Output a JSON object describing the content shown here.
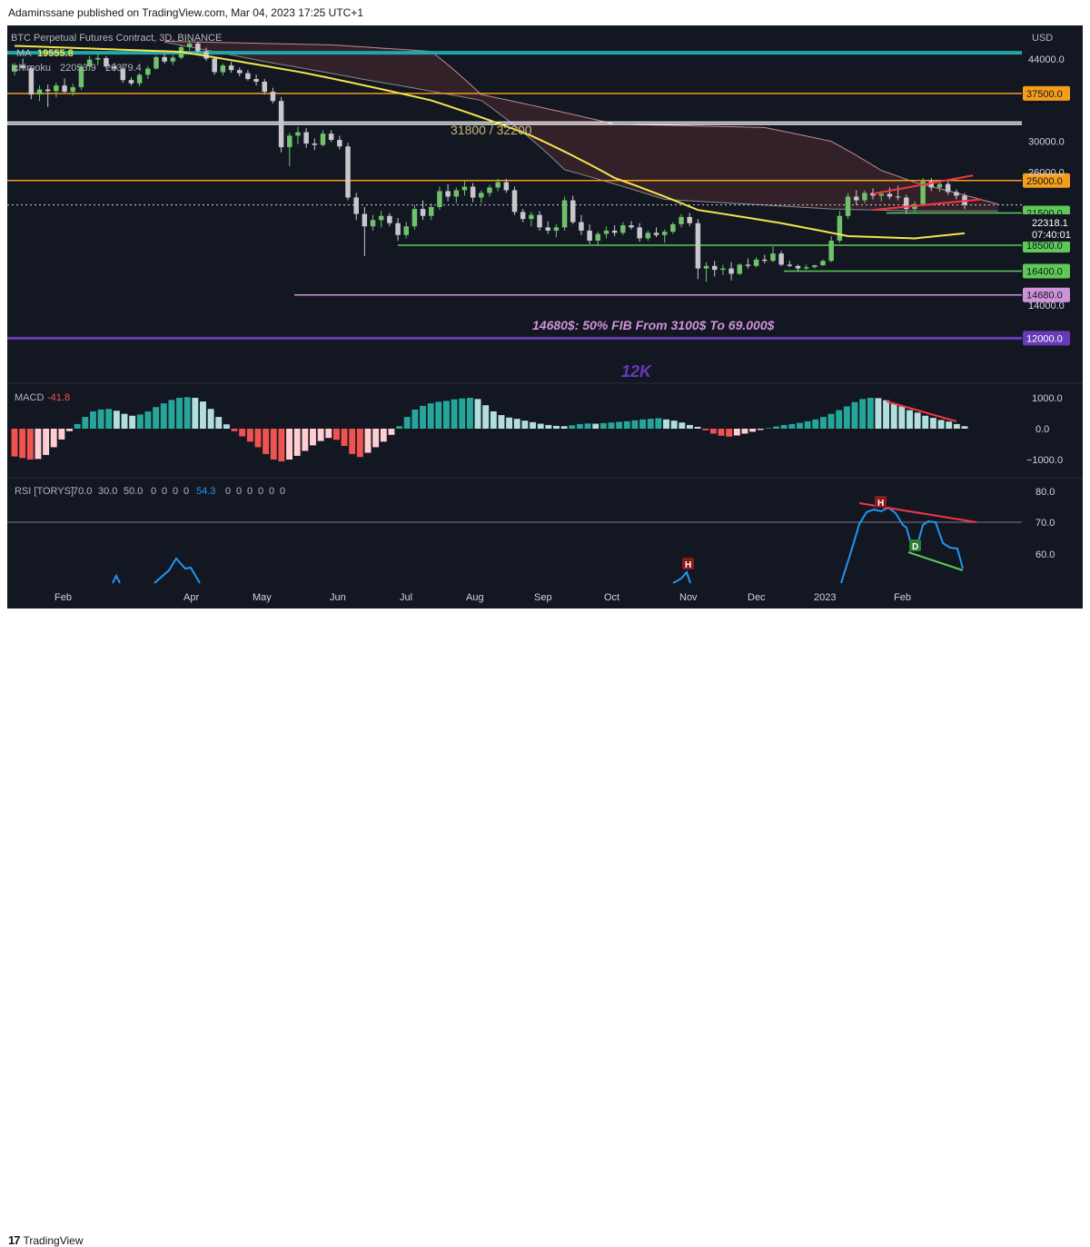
{
  "header": {
    "published": "Adaminssane published on TradingView.com, Mar 04, 2023 17:25 UTC+1"
  },
  "footer": {
    "brand": "TradingView",
    "brand_mark": "17"
  },
  "legend": {
    "symbol": "BTC Perpetual Futures Contract, 3D, BINANCE",
    "ma_label": "MA",
    "ma_value": "19555.8",
    "ichimoku_label": "Ichimoku",
    "ichimoku_v1": "22053.9",
    "ichimoku_v2": "20379.4",
    "currency": "USD"
  },
  "colors": {
    "bg": "#131722",
    "up": "#6fc16a",
    "down": "#c7c7cc",
    "ma": "#f5e44b",
    "cyan": "#1fa7a9",
    "orange": "#f59e1b",
    "purple": "#673ab7",
    "lilac": "#ce93d8",
    "green_line": "#5ec956",
    "red_line": "#f23645",
    "macd_up": "#26a69a",
    "macd_up_fade": "#b2dfdb",
    "macd_down": "#ef5350",
    "macd_down_fade": "#ffcdd2",
    "rsi": "#2196f3"
  },
  "chart_data": {
    "type": "candlestick",
    "timeframe": "3D",
    "y_axis": {
      "min": 10500,
      "max": 48500,
      "ticks": [
        44000,
        30000,
        26000,
        14000
      ]
    },
    "x_labels": [
      "Feb",
      "Apr",
      "May",
      "Jun",
      "Jul",
      "Aug",
      "Sep",
      "Oct",
      "Nov",
      "Dec",
      "2023",
      "Feb"
    ],
    "candles": [
      [
        41500,
        43200,
        40800,
        42800
      ],
      [
        42800,
        44100,
        41900,
        42200
      ],
      [
        42200,
        42600,
        36500,
        37300
      ],
      [
        37300,
        38900,
        36200,
        38200
      ],
      [
        38200,
        39100,
        35200,
        37900
      ],
      [
        37900,
        39400,
        36800,
        38900
      ],
      [
        38900,
        40200,
        37600,
        37800
      ],
      [
        37800,
        39200,
        37100,
        38600
      ],
      [
        38600,
        42800,
        38100,
        42500
      ],
      [
        42500,
        44700,
        41800,
        43900
      ],
      [
        43900,
        45100,
        42700,
        44200
      ],
      [
        44200,
        44600,
        42100,
        42500
      ],
      [
        42500,
        43200,
        41600,
        42100
      ],
      [
        42100,
        42800,
        39400,
        39900
      ],
      [
        39900,
        40400,
        38900,
        39300
      ],
      [
        39300,
        41200,
        38800,
        40900
      ],
      [
        40900,
        42600,
        40100,
        42100
      ],
      [
        42100,
        44700,
        41900,
        44400
      ],
      [
        44400,
        45200,
        43100,
        43500
      ],
      [
        43500,
        44800,
        42800,
        44300
      ],
      [
        44300,
        46900,
        44000,
        46500
      ],
      [
        46500,
        48100,
        45800,
        47300
      ],
      [
        47300,
        47800,
        45200,
        45600
      ],
      [
        45600,
        46400,
        43600,
        44100
      ],
      [
        44100,
        44500,
        40900,
        41400
      ],
      [
        41400,
        43100,
        40800,
        42700
      ],
      [
        42700,
        43400,
        41300,
        41800
      ],
      [
        41800,
        42300,
        40600,
        41200
      ],
      [
        41200,
        41800,
        39800,
        40100
      ],
      [
        40100,
        40900,
        38900,
        39600
      ],
      [
        39600,
        40100,
        37300,
        37800
      ],
      [
        37800,
        38500,
        35800,
        36200
      ],
      [
        36200,
        36900,
        28500,
        29200
      ],
      [
        29200,
        31200,
        26700,
        30800
      ],
      [
        30800,
        32100,
        29600,
        31300
      ],
      [
        31300,
        31900,
        29100,
        29700
      ],
      [
        29700,
        30400,
        28800,
        29500
      ],
      [
        29500,
        31600,
        29300,
        31100
      ],
      [
        31100,
        31600,
        29900,
        30200
      ],
      [
        30200,
        30800,
        28900,
        29300
      ],
      [
        29300,
        29800,
        22800,
        23100
      ],
      [
        23100,
        23600,
        20800,
        21400
      ],
      [
        21400,
        22100,
        17600,
        20200
      ],
      [
        20200,
        21300,
        19800,
        20800
      ],
      [
        20800,
        21700,
        20100,
        21200
      ],
      [
        21200,
        21500,
        20200,
        20500
      ],
      [
        20500,
        21000,
        18900,
        19400
      ],
      [
        19400,
        20600,
        19100,
        20200
      ],
      [
        20200,
        22300,
        19900,
        21900
      ],
      [
        21900,
        22800,
        20800,
        21200
      ],
      [
        21200,
        22500,
        20800,
        22100
      ],
      [
        22100,
        24300,
        21800,
        23800
      ],
      [
        23800,
        24600,
        22700,
        23200
      ],
      [
        23200,
        24200,
        22500,
        23900
      ],
      [
        23900,
        24900,
        23300,
        24300
      ],
      [
        24300,
        24700,
        22600,
        23100
      ],
      [
        23100,
        23900,
        22500,
        23600
      ],
      [
        23600,
        24500,
        23200,
        24200
      ],
      [
        24200,
        25200,
        23800,
        24800
      ],
      [
        24800,
        25200,
        23600,
        23900
      ],
      [
        23900,
        24300,
        21300,
        21600
      ],
      [
        21600,
        21900,
        20600,
        20900
      ],
      [
        20900,
        21600,
        20200,
        21300
      ],
      [
        21300,
        21700,
        19800,
        20100
      ],
      [
        20100,
        20700,
        19500,
        19800
      ],
      [
        19800,
        20400,
        19200,
        20100
      ],
      [
        20100,
        23200,
        19800,
        22800
      ],
      [
        22800,
        23300,
        20400,
        20600
      ],
      [
        20600,
        21300,
        19400,
        19800
      ],
      [
        19800,
        20400,
        18600,
        18900
      ],
      [
        18900,
        19700,
        18500,
        19500
      ],
      [
        19500,
        20200,
        19100,
        19800
      ],
      [
        19800,
        20300,
        19300,
        19600
      ],
      [
        19600,
        20600,
        19400,
        20300
      ],
      [
        20300,
        20700,
        19900,
        20100
      ],
      [
        20100,
        20500,
        18800,
        19100
      ],
      [
        19100,
        19800,
        18900,
        19600
      ],
      [
        19600,
        20100,
        19200,
        19400
      ],
      [
        19400,
        19900,
        18700,
        19700
      ],
      [
        19700,
        20600,
        19500,
        20400
      ],
      [
        20400,
        21400,
        20100,
        21100
      ],
      [
        21100,
        21500,
        20200,
        20500
      ],
      [
        20500,
        20900,
        15800,
        16600
      ],
      [
        16600,
        17100,
        15600,
        16800
      ],
      [
        16800,
        17200,
        16000,
        16500
      ],
      [
        16500,
        16900,
        16100,
        16600
      ],
      [
        16600,
        17100,
        15700,
        16200
      ],
      [
        16200,
        17000,
        16100,
        16900
      ],
      [
        16900,
        17400,
        16600,
        16800
      ],
      [
        16800,
        17500,
        16700,
        17300
      ],
      [
        17300,
        17700,
        17000,
        17200
      ],
      [
        17200,
        18400,
        17100,
        17800
      ],
      [
        17800,
        18000,
        16800,
        16900
      ],
      [
        16900,
        17200,
        16700,
        16800
      ],
      [
        16800,
        16900,
        16400,
        16600
      ],
      [
        16600,
        16900,
        16500,
        16700
      ],
      [
        16700,
        16900,
        16600,
        16850
      ],
      [
        16850,
        17300,
        16800,
        17200
      ],
      [
        17200,
        19300,
        17100,
        18900
      ],
      [
        18900,
        21700,
        18700,
        21200
      ],
      [
        21200,
        23600,
        20900,
        23200
      ],
      [
        23200,
        23900,
        22300,
        22800
      ],
      [
        22800,
        23900,
        22500,
        23600
      ],
      [
        23600,
        24100,
        22900,
        23300
      ],
      [
        23300,
        23800,
        22700,
        23500
      ],
      [
        23500,
        24200,
        22900,
        23200
      ],
      [
        23200,
        24400,
        22800,
        23100
      ],
      [
        23100,
        23400,
        21400,
        21900
      ],
      [
        21900,
        22700,
        21600,
        22400
      ],
      [
        22400,
        25300,
        22200,
        24900
      ],
      [
        24900,
        25300,
        23800,
        24200
      ],
      [
        24200,
        25100,
        23700,
        24600
      ],
      [
        24600,
        25000,
        23400,
        23700
      ],
      [
        23700,
        24000,
        22900,
        23300
      ],
      [
        23300,
        23600,
        21900,
        22318
      ]
    ],
    "ma_series": [
      {
        "i": 0,
        "v": 46800
      },
      {
        "i": 20,
        "v": 45500
      },
      {
        "i": 35,
        "v": 41200
      },
      {
        "i": 50,
        "v": 36300
      },
      {
        "i": 62,
        "v": 30800
      },
      {
        "i": 72,
        "v": 25300
      },
      {
        "i": 82,
        "v": 21800
      },
      {
        "i": 92,
        "v": 20500
      },
      {
        "i": 100,
        "v": 19300
      },
      {
        "i": 108,
        "v": 19100
      },
      {
        "i": 114,
        "v": 19555.8
      }
    ],
    "ichimoku_upper": [
      {
        "i": 18,
        "v": 47800
      },
      {
        "i": 38,
        "v": 47000
      },
      {
        "i": 50,
        "v": 45600
      },
      {
        "i": 56,
        "v": 37300
      },
      {
        "i": 72,
        "v": 32500
      },
      {
        "i": 90,
        "v": 32000
      },
      {
        "i": 98,
        "v": 30000
      },
      {
        "i": 104,
        "v": 26200
      },
      {
        "i": 108,
        "v": 24800
      },
      {
        "i": 118,
        "v": 22400
      }
    ],
    "ichimoku_lower": [
      {
        "i": 18,
        "v": 47600
      },
      {
        "i": 30,
        "v": 43500
      },
      {
        "i": 42,
        "v": 40000
      },
      {
        "i": 56,
        "v": 36300
      },
      {
        "i": 66,
        "v": 26300
      },
      {
        "i": 78,
        "v": 22900
      },
      {
        "i": 98,
        "v": 21900
      },
      {
        "i": 108,
        "v": 21700
      },
      {
        "i": 118,
        "v": 21700
      }
    ],
    "horizontal_levels": [
      {
        "price": 45300,
        "color": "#1fa7a9",
        "label": ""
      },
      {
        "price": 37500,
        "color": "#f59e1b",
        "label": "37500.0"
      },
      {
        "price": 32800,
        "color": "#ffffff",
        "label": ""
      },
      {
        "price": 32500,
        "color": "#ffffff",
        "label": ""
      },
      {
        "price": 25000,
        "color": "#f59e1b",
        "label": "25000.0"
      },
      {
        "price": 21500,
        "color": "#5ec956",
        "label": "21500.0"
      },
      {
        "price": 18500,
        "color": "#5ec956",
        "label": "18500.0"
      },
      {
        "price": 16400,
        "color": "#5ec956",
        "label": "16400.0"
      },
      {
        "price": 14680,
        "color": "#ce93d8",
        "label": "14680.0"
      },
      {
        "price": 12000,
        "color": "#673ab7",
        "label": "12000.0"
      }
    ],
    "current_price": {
      "value": "22318.1",
      "countdown": "07:40:01"
    },
    "annotations": {
      "resistance_zone": "31800 / 32200",
      "fib_note": "14680$: 50% FIB From 3100$ To 69.000$",
      "target": "12K"
    },
    "macd": {
      "label": "MACD",
      "value": "-41.8",
      "ticks": [
        "1000.0",
        "0.0",
        "−1000.0"
      ],
      "hist": [
        -900,
        -950,
        -1000,
        -980,
        -850,
        -600,
        -350,
        -80,
        150,
        380,
        560,
        620,
        640,
        580,
        480,
        420,
        460,
        560,
        700,
        820,
        930,
        1000,
        1020,
        1000,
        880,
        640,
        380,
        140,
        -80,
        -250,
        -420,
        -600,
        -820,
        -1000,
        -1060,
        -1000,
        -880,
        -720,
        -540,
        -400,
        -300,
        -360,
        -560,
        -820,
        -920,
        -780,
        -600,
        -420,
        -200,
        80,
        380,
        620,
        740,
        820,
        870,
        900,
        950,
        980,
        1000,
        960,
        760,
        560,
        440,
        360,
        320,
        260,
        210,
        160,
        120,
        90,
        80,
        110,
        150,
        170,
        160,
        180,
        200,
        220,
        240,
        270,
        300,
        320,
        340,
        300,
        260,
        200,
        120,
        60,
        -50,
        -160,
        -230,
        -260,
        -220,
        -160,
        -100,
        -40,
        20,
        70,
        120,
        150,
        190,
        240,
        300,
        380,
        480,
        600,
        720,
        860,
        960,
        1000,
        990,
        920,
        800,
        720,
        600,
        520,
        420,
        350,
        280,
        230,
        150,
        80
      ]
    },
    "rsi": {
      "label": "RSI [TORYS]",
      "params": [
        "70.0",
        "30.0",
        "50.0",
        "0",
        "0",
        "0",
        "0"
      ],
      "value": "54.3",
      "params2": [
        "0",
        "0",
        "0",
        "0",
        "0",
        "0"
      ],
      "ticks": [
        "80.0",
        "70.0",
        "60.0"
      ],
      "markers": [
        "H",
        "H",
        "D"
      ]
    }
  }
}
